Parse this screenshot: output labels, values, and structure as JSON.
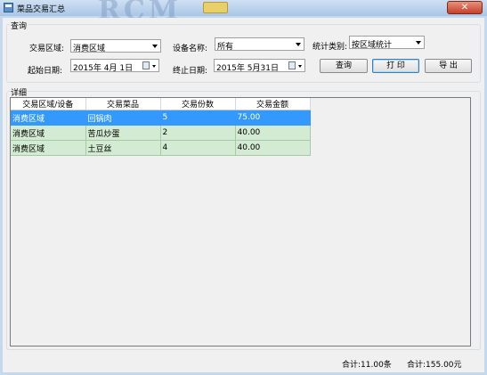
{
  "window": {
    "title": "菜品交易汇总",
    "watermark": "RCM",
    "close_label": "✕"
  },
  "query": {
    "group_label": "查询",
    "area_label": "交易区域:",
    "area_value": "消费区域",
    "device_label": "设备名称:",
    "device_value": "所有",
    "stat_label": "统计类别:",
    "stat_value": "按区域统计",
    "start_label": "起始日期:",
    "start_value": "2015年 4月 1日",
    "end_label": "终止日期:",
    "end_value": "2015年 5月31日",
    "query_button": "查询",
    "print_button": "打 印",
    "export_button": "导 出"
  },
  "detail": {
    "group_label": "详细",
    "columns": [
      "交易区域/设备",
      "交易菜品",
      "交易份数",
      "交易金额"
    ],
    "rows": [
      [
        "消费区域",
        "回锅肉",
        "5",
        "75.00"
      ],
      [
        "消费区域",
        "苦瓜炒蛋",
        "2",
        "40.00"
      ],
      [
        "消费区域",
        "土豆丝",
        "4",
        "40.00"
      ]
    ],
    "selected_row": 0
  },
  "footer": {
    "total_count": "合计:11.00条",
    "total_amount": "合计:155.00元"
  }
}
